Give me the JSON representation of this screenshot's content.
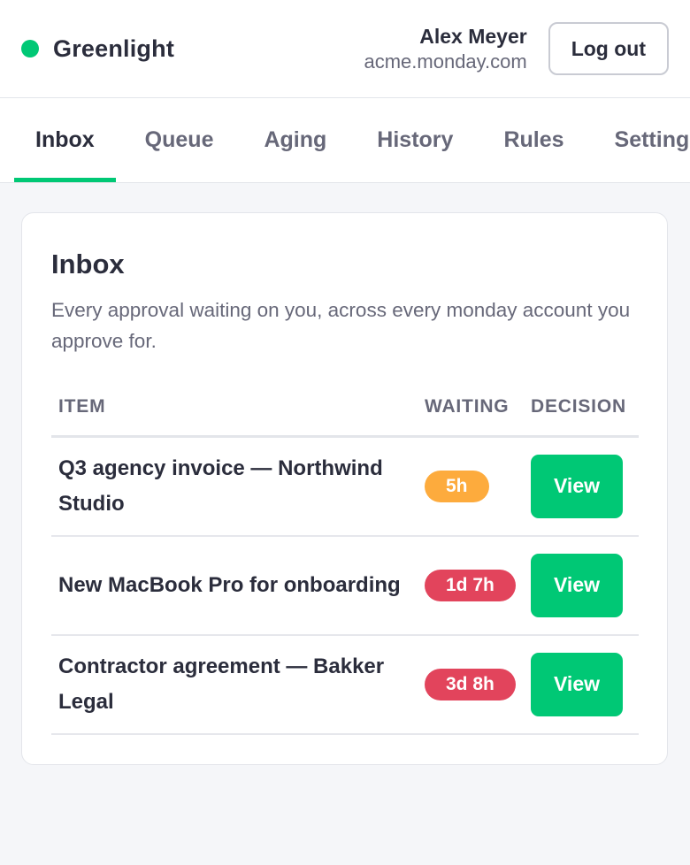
{
  "app": {
    "name": "Greenlight",
    "status_color": "#00c875",
    "status_icon": "status-dot"
  },
  "account": {
    "user": "Alex Meyer",
    "domain": "acme.monday.com",
    "logout_label": "Log out"
  },
  "tabs": [
    {
      "label": "Inbox",
      "active": true
    },
    {
      "label": "Queue",
      "active": false
    },
    {
      "label": "Aging",
      "active": false
    },
    {
      "label": "History",
      "active": false
    },
    {
      "label": "Rules",
      "active": false
    },
    {
      "label": "Settings",
      "active": false
    }
  ],
  "inbox": {
    "title": "Inbox",
    "subtitle": "Every approval waiting on you, across every monday account you approve for.",
    "columns": {
      "item": "ITEM",
      "waiting": "WAITING",
      "decision": "DECISION"
    },
    "rows": [
      {
        "item": "Q3 agency invoice — Northwind Studio",
        "waiting": "5h",
        "waiting_color": "#fdab3d",
        "action": "View"
      },
      {
        "item": "New MacBook Pro for onboarding",
        "waiting": "1d 7h",
        "waiting_color": "#e2445c",
        "action": "View"
      },
      {
        "item": "Contractor agreement — Bakker Legal",
        "waiting": "3d 8h",
        "waiting_color": "#e2445c",
        "action": "View"
      }
    ]
  },
  "colors": {
    "accent": "#00c875",
    "warning": "#fdab3d",
    "danger": "#e2445c"
  }
}
